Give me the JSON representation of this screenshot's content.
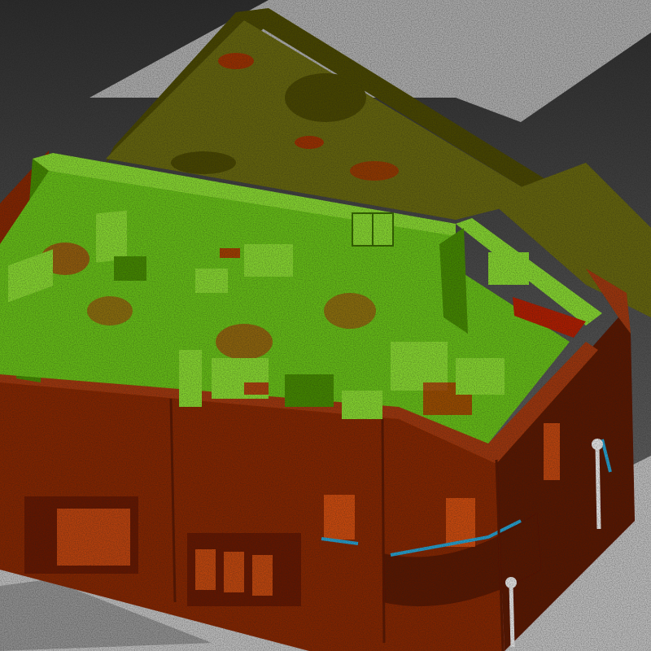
{
  "scene": {
    "kind": "point-cloud-scan",
    "subject": "building-with-rooftop-terrace",
    "colors": {
      "background_top": "#2b2b2b",
      "background_bottom": "#6b6b6b",
      "ground": "#c9c9c9",
      "ground_dark": "#9a9a9a",
      "facade": "#8a2a08",
      "facade_dark": "#5e1a04",
      "facade_light": "#a63a12",
      "roof_green": "#6cc61c",
      "roof_green_light": "#8de036",
      "roof_green_dark": "#4a8f10",
      "rear_olive": "#6b6a16",
      "rear_olive_dark": "#4d4c10",
      "debris_red": "#b8200c",
      "accent_cyan": "#2aa7d8",
      "window_orange": "#e0561c",
      "lamp_white": "#dcdcdc"
    }
  }
}
